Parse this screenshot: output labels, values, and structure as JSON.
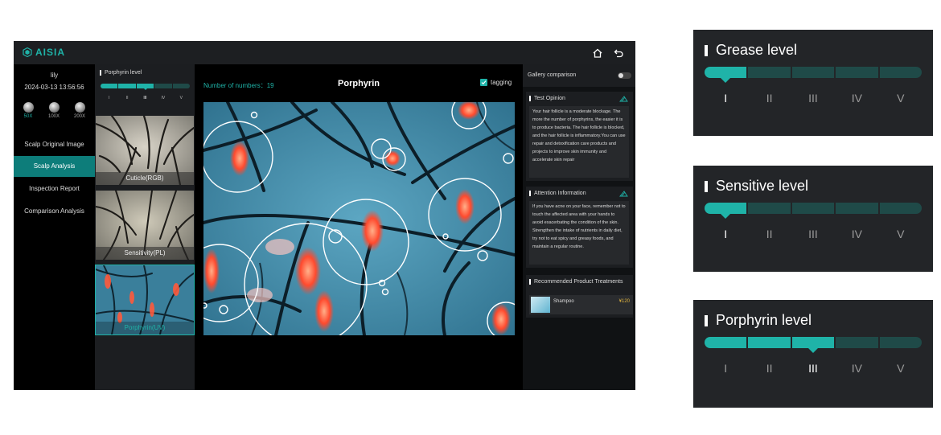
{
  "app": {
    "logo_text": "AISIA"
  },
  "user": {
    "name": "lily",
    "datetime": "2024-03-13 13:56:56"
  },
  "zoom_levels": [
    {
      "label": "50X",
      "active": true
    },
    {
      "label": "100X",
      "active": false
    },
    {
      "label": "200X",
      "active": false
    }
  ],
  "nav": [
    {
      "label": "Scalp Original Image",
      "active": false
    },
    {
      "label": "Scalp Analysis",
      "active": true
    },
    {
      "label": "Inspection Report",
      "active": false
    },
    {
      "label": "Comparison Analysis",
      "active": false
    }
  ],
  "thumb_panel": {
    "level_label": "Porphyrin level",
    "level_value": 3,
    "romans": [
      "I",
      "II",
      "III",
      "IV",
      "V"
    ]
  },
  "thumbs": [
    {
      "caption": "Cuticle(RGB)",
      "active": false
    },
    {
      "caption": "Sensitivity(PL)",
      "active": false
    },
    {
      "caption": "Porphyrin(UV)",
      "active": true
    }
  ],
  "center": {
    "number_label": "Number of numbers：19",
    "title": "Porphyrin",
    "tagging_label": "tagging"
  },
  "right": {
    "gallery_label": "Gallery comparison",
    "test_opinion_title": "Test Opinion",
    "test_opinion_text": "Your hair follicle is a moderate blockage. The more the number of porphyrins, the easier it is to produce bacteria. The hair follicle is blocked, and the hair follicle is inflammatory.You can use repair and detoxification care products and projects to improve skin immunity and accelerate skin repair",
    "attention_title": "Attention Information",
    "attention_text": "If you have acne on your face, remember not to touch the affected area with your hands to avoid exacerbating the condition of the skin. Strengthen the intake of nutrients in daily diet, try not to eat spicy and greasy foods, and maintain a regular routine.",
    "recommend_title": "Recommended Product Treatments",
    "product_name": "Shampoo",
    "product_price": "¥120"
  },
  "level_cards": [
    {
      "title": "Grease level",
      "value": 1
    },
    {
      "title": "Sensitive level",
      "value": 1
    },
    {
      "title": "Porphyrin level",
      "value": 3
    }
  ],
  "romans": [
    "I",
    "II",
    "III",
    "IV",
    "V"
  ],
  "colors": {
    "accent": "#1fb3a8",
    "active_nav": "#0d7d7a",
    "seg_off": "#1f4a48",
    "price": "#e0b43e"
  },
  "icons": {
    "home": "home-icon",
    "back": "back-icon",
    "edit": "edit-icon"
  }
}
